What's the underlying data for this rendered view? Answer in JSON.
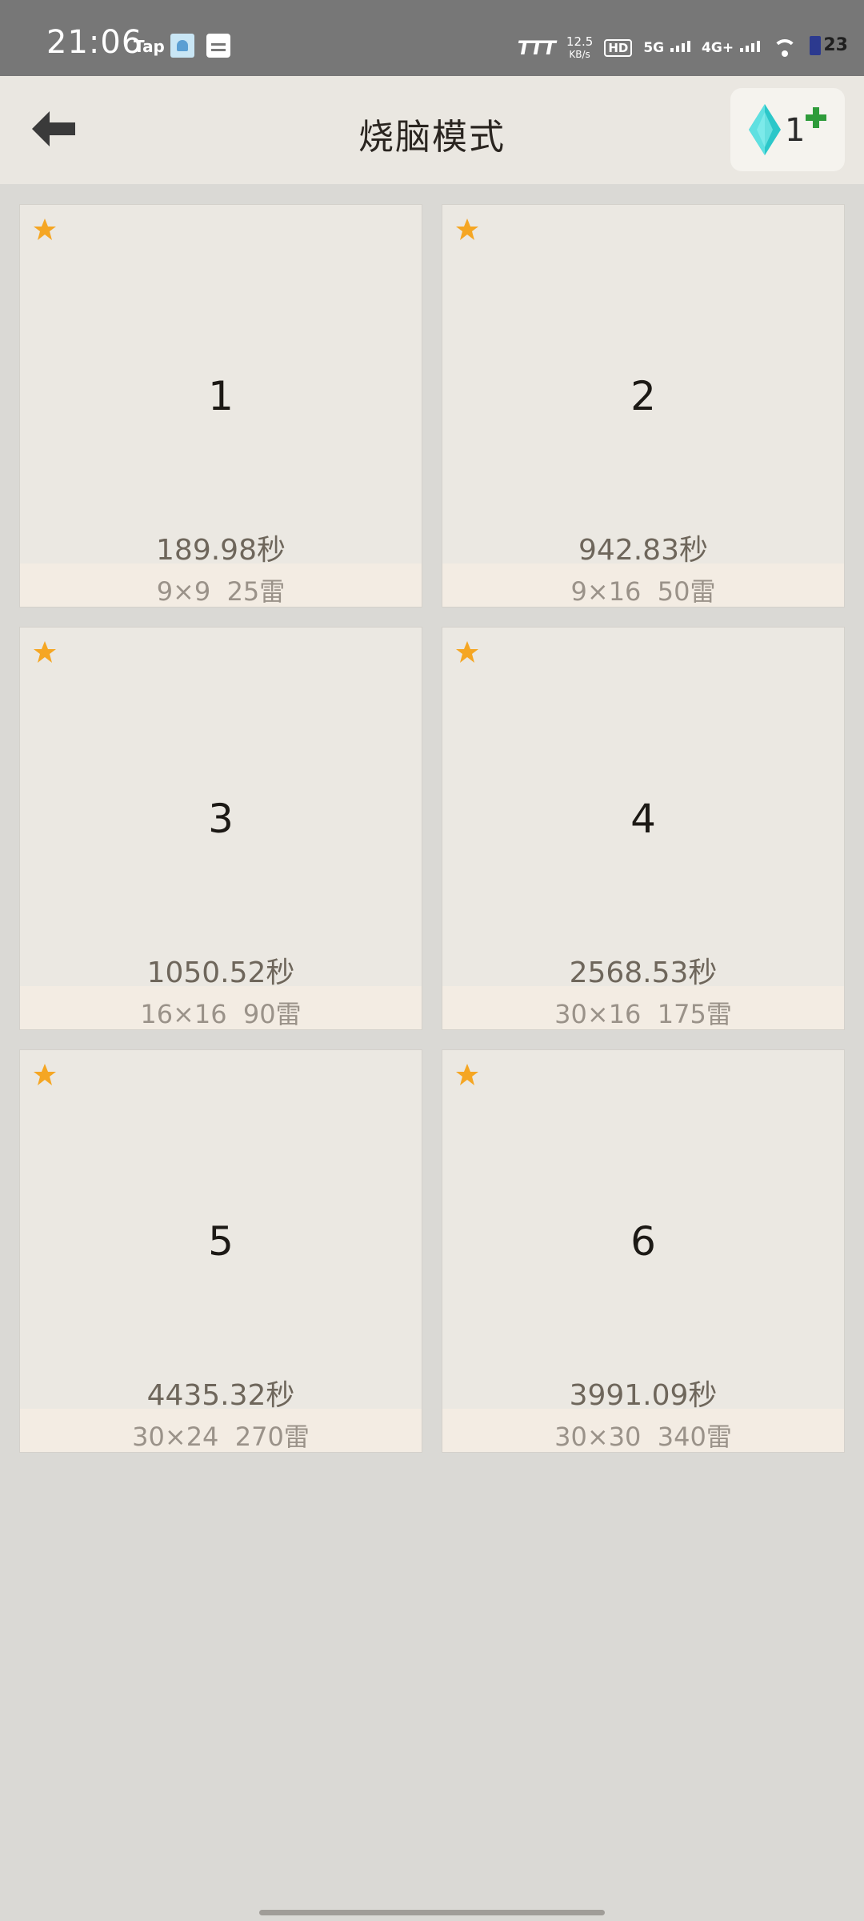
{
  "status_bar": {
    "time": "21:06",
    "tap_label": "Tap",
    "net_logo": "TTT",
    "net_speed": "12.5",
    "net_speed_unit": "KB/s",
    "hd_label": "HD",
    "sim_5g": "5G",
    "sim_4g": "4G+",
    "battery": "23"
  },
  "header": {
    "title": "烧脑模式",
    "gem_count": "1"
  },
  "levels": [
    {
      "number": "1",
      "time": "189.98秒",
      "info": "9×9  25雷"
    },
    {
      "number": "2",
      "time": "942.83秒",
      "info": "9×16  50雷"
    },
    {
      "number": "3",
      "time": "1050.52秒",
      "info": "16×16  90雷"
    },
    {
      "number": "4",
      "time": "2568.53秒",
      "info": "30×16  175雷"
    },
    {
      "number": "5",
      "time": "4435.32秒",
      "info": "30×24  270雷"
    },
    {
      "number": "6",
      "time": "3991.09秒",
      "info": "30×30  340雷"
    }
  ],
  "colors": {
    "star": "#f5a623",
    "gem": "#2bc7c9",
    "plus": "#2e9b3a",
    "background": "#dad9d5",
    "card": "#ebe8e2"
  }
}
